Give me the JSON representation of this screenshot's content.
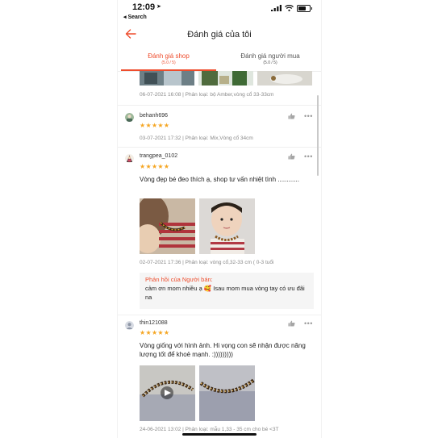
{
  "status_bar": {
    "time": "12:09",
    "back_to_app": "◂ Search"
  },
  "header": {
    "title": "Đánh giá của tôi"
  },
  "tabs": [
    {
      "label": "Đánh giá shop",
      "count": "(5.0 / 5)",
      "active": true
    },
    {
      "label": "Đánh giá người mua",
      "count": "(5.0 / 5)",
      "active": false
    }
  ],
  "previous_review": {
    "meta": "06-07-2021 16:08 | Phân loại: bộ Amber,vòng cổ 33-33cm"
  },
  "reviews": [
    {
      "username": "behanh696",
      "stars": "★★★★★",
      "rating": 5,
      "meta": "03-07-2021 17:32 | Phân loại: Mix,Vòng cổ 34cm"
    },
    {
      "username": "trangpea_0102",
      "stars": "★★★★★",
      "rating": 5,
      "text": "Vòng đẹp bé đeo thích ạ, shop tư vấn nhiệt tình ............",
      "meta": "02-07-2021 17:36 | Phân loại: vòng cổ,32-33 cm ( 0-3 tuổi",
      "seller_reply": {
        "title": "Phản hồi của Người bán:",
        "text": "cảm ơn mom nhiều ạ 🥰 Isau mom mua vòng tay có ưu đãi na"
      }
    },
    {
      "username": "thin121088",
      "stars": "★★★★★",
      "rating": 5,
      "text": "Vòng giống với hình ảnh. Hi vọng con sẽ nhận được năng lượng tốt để khoẻ mạnh. :)))))))))",
      "meta": "24-06-2021 13:02 | Phân loại: mẫu 1,33 - 35 cm cho bé <3T"
    }
  ],
  "colors": {
    "accent": "#ee4d2d",
    "star": "#f5a623",
    "meta_text": "#8a8a8a"
  }
}
